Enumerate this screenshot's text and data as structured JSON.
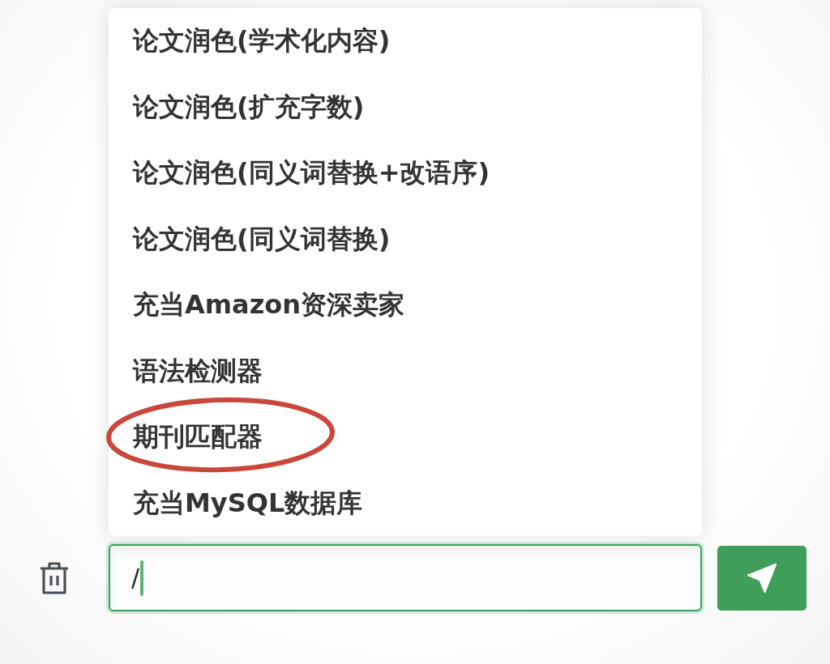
{
  "prompt_menu": {
    "items": [
      {
        "label": "论文润色(学术化内容)",
        "circled": false
      },
      {
        "label": "论文润色(扩充字数)",
        "circled": false
      },
      {
        "label": "论文润色(同义词替换+改语序)",
        "circled": false
      },
      {
        "label": "论文润色(同义词替换)",
        "circled": false
      },
      {
        "label": "充当Amazon资深卖家",
        "circled": false
      },
      {
        "label": "语法检测器",
        "circled": false
      },
      {
        "label": "期刊匹配器",
        "circled": true
      },
      {
        "label": "充当MySQL数据库",
        "circled": false
      }
    ]
  },
  "composer": {
    "value": "/",
    "focused": true
  }
}
